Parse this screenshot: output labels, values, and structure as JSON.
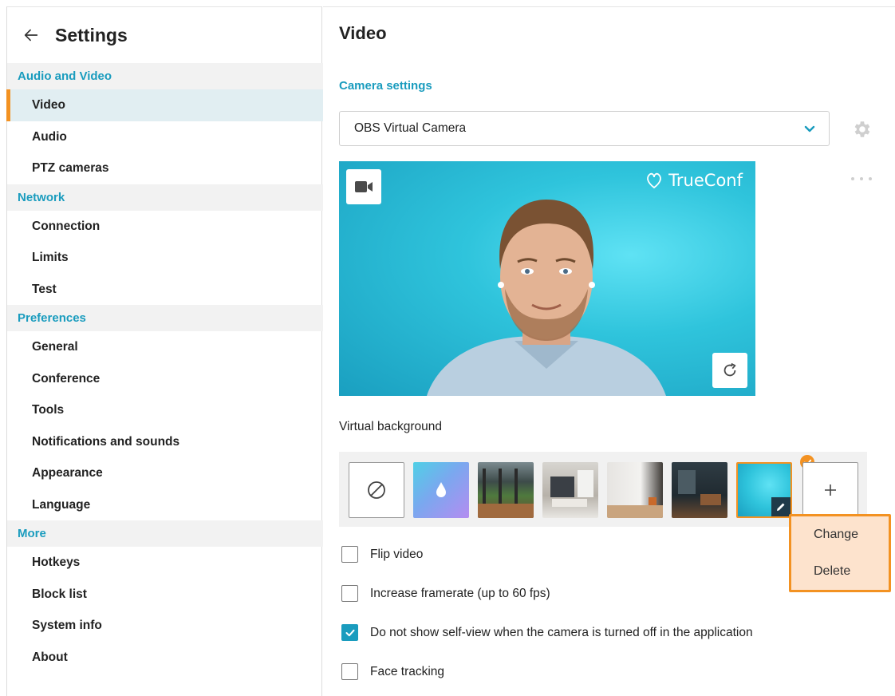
{
  "sidebar": {
    "title": "Settings",
    "groups": [
      {
        "label": "Audio and Video",
        "items": [
          "Video",
          "Audio",
          "PTZ cameras"
        ]
      },
      {
        "label": "Network",
        "items": [
          "Connection",
          "Limits",
          "Test"
        ]
      },
      {
        "label": "Preferences",
        "items": [
          "General",
          "Conference",
          "Tools",
          "Notifications and sounds",
          "Appearance",
          "Language"
        ]
      },
      {
        "label": "More",
        "items": [
          "Hotkeys",
          "Block list",
          "System info",
          "About"
        ]
      }
    ],
    "active_item": "Video"
  },
  "main": {
    "title": "Video",
    "camera_section_title": "Camera settings",
    "camera_select_value": "OBS Virtual Camera",
    "preview_logo_text": "TrueConf",
    "virtual_background_label": "Virtual background",
    "context_menu": {
      "change": "Change",
      "delete": "Delete"
    },
    "checkboxes": [
      {
        "label": "Flip video",
        "checked": false
      },
      {
        "label": "Increase framerate (up to 60 fps)",
        "checked": false
      },
      {
        "label": "Do not show self-view when the camera is turned off in the application",
        "checked": true
      },
      {
        "label": "Face tracking",
        "checked": false
      }
    ]
  },
  "colors": {
    "accent": "#1a9cbe",
    "highlight": "#f39222",
    "active_bg": "#e1eef2",
    "group_bg": "#f2f2f2"
  },
  "icons": [
    "back-arrow-icon",
    "chevron-down-icon",
    "gear-icon",
    "more-dots-icon",
    "video-camera-icon",
    "rotate-icon",
    "no-background-icon",
    "plus-icon",
    "pencil-icon",
    "checkmark-icon"
  ]
}
